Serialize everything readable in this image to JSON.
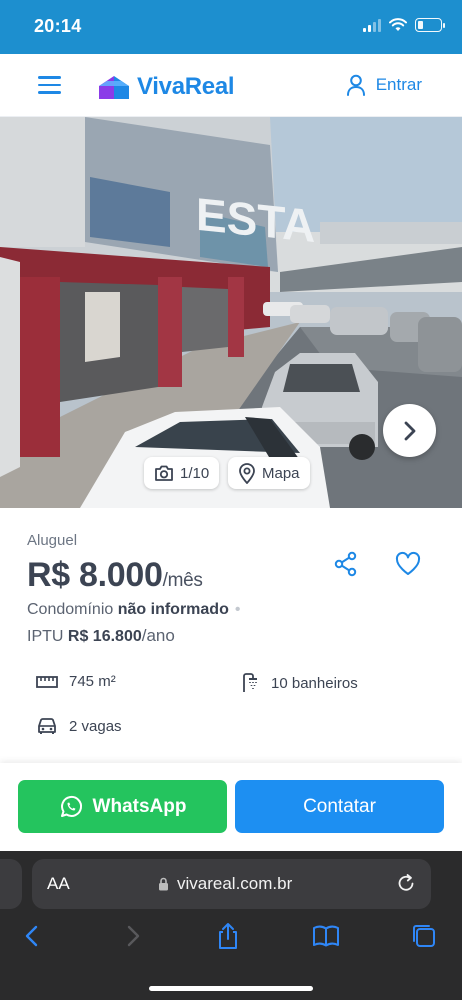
{
  "status_bar": {
    "time": "20:14"
  },
  "header": {
    "brand": "VivaReal",
    "login_label": "Entrar"
  },
  "gallery": {
    "counter": "1/10",
    "map_label": "Mapa",
    "sign_text": "ESTA"
  },
  "listing": {
    "business_type": "Aluguel",
    "price": "R$ 8.000",
    "price_period": "/mês",
    "condo_label": "Condomínio",
    "condo_value": "não informado",
    "iptu_label": "IPTU",
    "iptu_value": "R$ 16.800",
    "iptu_period": "/ano",
    "area": "745 m²",
    "bathrooms": "10 banheiros",
    "parking": "2 vagas"
  },
  "actions": {
    "whatsapp_label": "WhatsApp",
    "contact_label": "Contatar"
  },
  "browser": {
    "text_size_label": "AA",
    "url": "vivareal.com.br"
  },
  "colors": {
    "brand_blue": "#1e88e5",
    "status_bar": "#1d8fcf",
    "whatsapp_green": "#24c45e",
    "contact_blue": "#1d8ff2"
  }
}
